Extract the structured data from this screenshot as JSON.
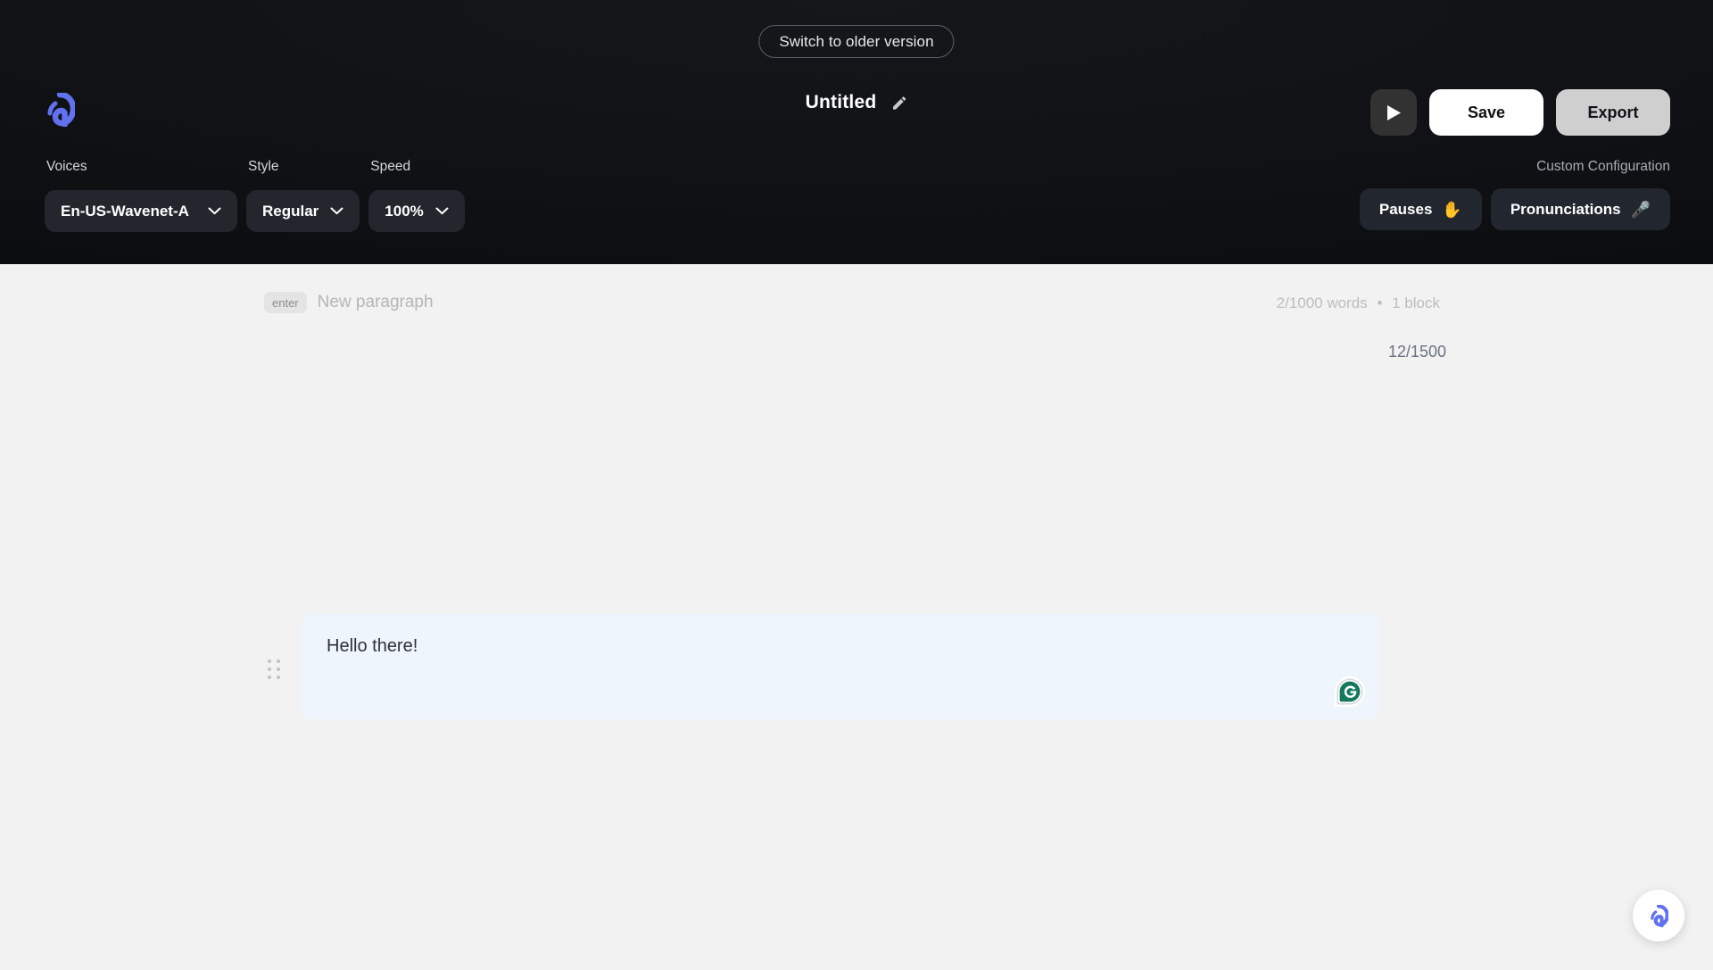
{
  "header": {
    "switch_version_label": "Switch to older version",
    "logo_icon": "app-logo-icon",
    "document_title": "Untitled",
    "edit_title_icon": "pencil-icon",
    "play_icon": "play-icon",
    "save_label": "Save",
    "export_label": "Export",
    "custom_config_label": "Custom Configuration",
    "config_buttons": [
      {
        "label": "Pauses",
        "icon": "raised-hand-icon",
        "glyph": "✋"
      },
      {
        "label": "Pronunciations",
        "icon": "microphone-icon",
        "glyph": "🎤"
      }
    ],
    "selectors": [
      {
        "label": "Voices",
        "value": "En-US-Wavenet-A",
        "icon": "chevron-down-icon"
      },
      {
        "label": "Style",
        "value": "Regular",
        "icon": "chevron-down-icon"
      },
      {
        "label": "Speed",
        "value": "100%",
        "icon": "chevron-down-icon"
      }
    ],
    "colors": {
      "background": "#0e1013",
      "accent": "#6271f0",
      "save_bg": "#ffffff",
      "export_bg": "#cfcfcf",
      "control_bg": "#23262d"
    }
  },
  "editor": {
    "new_paragraph_key": "enter",
    "new_paragraph_hint": "New paragraph",
    "word_count": "2/1000 words",
    "separator": "•",
    "block_count": "1 block",
    "char_counter": "12/1500",
    "blocks": [
      {
        "text": "Hello there!",
        "drag_handle_icon": "drag-handle-icon",
        "extension_badge_icon": "grammarly-icon"
      }
    ],
    "colors": {
      "page_bg": "#f2f2f2",
      "block_bg": "#eef5fd",
      "grammarly_green": "#15past"
    }
  },
  "floating": {
    "assistant_icon": "app-logo-icon"
  }
}
